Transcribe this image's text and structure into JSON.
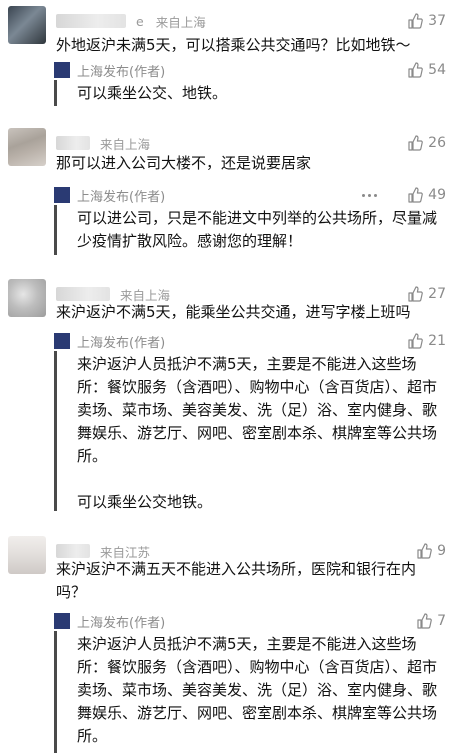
{
  "comments": [
    {
      "meta_suffix": "e",
      "location": "来自上海",
      "likes": "37",
      "text": "外地返沪未满5天，可以搭乘公共交通吗？比如地铁～",
      "reply": {
        "name": "上海发布(作者)",
        "likes": "54",
        "paragraphs": [
          "可以乘坐公交、地铁。"
        ]
      }
    },
    {
      "meta_suffix": "",
      "location": "来自上海",
      "likes": "26",
      "text": "那可以进入公司大楼不，还是说要居家",
      "reply": {
        "name": "上海发布(作者)",
        "likes": "49",
        "paragraphs": [
          "可以进公司，只是不能进文中列举的公共场所，尽量减少疫情扩散风险。感谢您的理解！"
        ]
      }
    },
    {
      "meta_suffix": "",
      "location": "来自上海",
      "likes": "27",
      "text": "来沪返沪不满5天，能乘坐公共交通，进写字楼上班吗",
      "reply": {
        "name": "上海发布(作者)",
        "likes": "21",
        "paragraphs": [
          "来沪返沪人员抵沪不满5天，主要是不能进入这些场所：餐饮服务（含酒吧）、购物中心（含百货店）、超市卖场、菜市场、美容美发、洗（足）浴、室内健身、歌舞娱乐、游艺厅、网吧、密室剧本杀、棋牌室等公共场所。",
          "可以乘坐公交地铁。"
        ]
      }
    },
    {
      "meta_suffix": "",
      "location": "来自江苏",
      "likes": "9",
      "text": "来沪返沪不满五天不能进入公共场所，医院和银行在内吗？",
      "reply": {
        "name": "上海发布(作者)",
        "likes": "7",
        "paragraphs": [
          "来沪返沪人员抵沪不满5天，主要是不能进入这些场所：餐饮服务（含酒吧）、购物中心（含百货店）、超市卖场、菜市场、美容美发、洗（足）浴、室内健身、歌舞娱乐、游艺厅、网吧、密室剧本杀、棋牌室等公共场所。"
        ]
      }
    }
  ],
  "colors": {
    "reply_bar": "#4a4a4a",
    "logo_bg": "#2a3a73",
    "muted_text": "#9a9a9a"
  },
  "icons": {
    "like": "thumbs-up-icon",
    "more": "more-dots-icon"
  }
}
